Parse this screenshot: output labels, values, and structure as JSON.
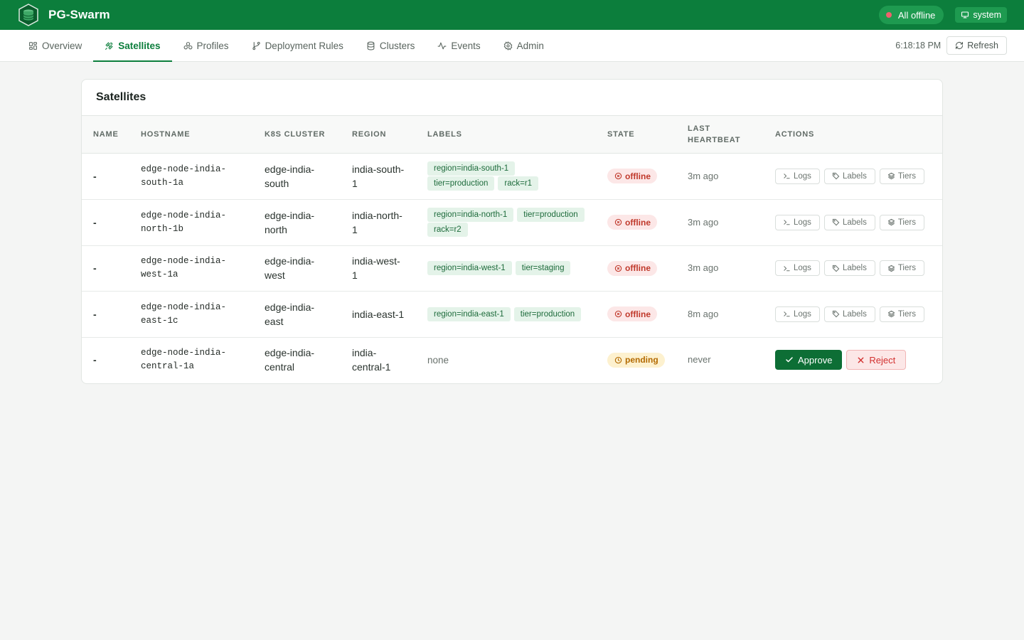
{
  "app": {
    "title": "PG-Swarm"
  },
  "header": {
    "status_text": "All offline",
    "user": "system",
    "colors": {
      "brand": "#0c7e3c",
      "status_dot": "#f0616d"
    }
  },
  "nav": {
    "tabs": [
      {
        "label": "Overview",
        "icon": "grid-icon"
      },
      {
        "label": "Satellites",
        "icon": "satellite-icon"
      },
      {
        "label": "Profiles",
        "icon": "profiles-icon"
      },
      {
        "label": "Deployment Rules",
        "icon": "git-branch-icon"
      },
      {
        "label": "Clusters",
        "icon": "database-icon"
      },
      {
        "label": "Events",
        "icon": "activity-icon"
      },
      {
        "label": "Admin",
        "icon": "gear-icon"
      }
    ],
    "active_tab": "Satellites",
    "clock": "6:18:18 PM",
    "refresh_label": "Refresh"
  },
  "satellites": {
    "title": "Satellites",
    "columns": [
      "Name",
      "Hostname",
      "K8s Cluster",
      "Region",
      "Labels",
      "State",
      "Last Heartbeat",
      "Actions"
    ],
    "rows": [
      {
        "name": "-",
        "hostname": "edge-node-india-south-1a",
        "k8s_cluster": "edge-india-south",
        "region": "india-south-1",
        "labels": [
          "region=india-south-1",
          "tier=production",
          "rack=r1"
        ],
        "state": "offline",
        "last_heartbeat": "3m ago"
      },
      {
        "name": "-",
        "hostname": "edge-node-india-north-1b",
        "k8s_cluster": "edge-india-north",
        "region": "india-north-1",
        "labels": [
          "region=india-north-1",
          "tier=production",
          "rack=r2"
        ],
        "state": "offline",
        "last_heartbeat": "3m ago"
      },
      {
        "name": "-",
        "hostname": "edge-node-india-west-1a",
        "k8s_cluster": "edge-india-west",
        "region": "india-west-1",
        "labels": [
          "region=india-west-1",
          "tier=staging"
        ],
        "state": "offline",
        "last_heartbeat": "3m ago"
      },
      {
        "name": "-",
        "hostname": "edge-node-india-east-1c",
        "k8s_cluster": "edge-india-east",
        "region": "india-east-1",
        "labels": [
          "region=india-east-1",
          "tier=production"
        ],
        "state": "offline",
        "last_heartbeat": "8m ago"
      },
      {
        "name": "-",
        "hostname": "edge-node-india-central-1a",
        "k8s_cluster": "edge-india-central",
        "region": "india-central-1",
        "labels": [],
        "labels_empty": "none",
        "state": "pending",
        "last_heartbeat": "never"
      }
    ],
    "action_labels": {
      "logs": "Logs",
      "labels": "Labels",
      "tiers": "Tiers",
      "approve": "Approve",
      "reject": "Reject"
    }
  }
}
